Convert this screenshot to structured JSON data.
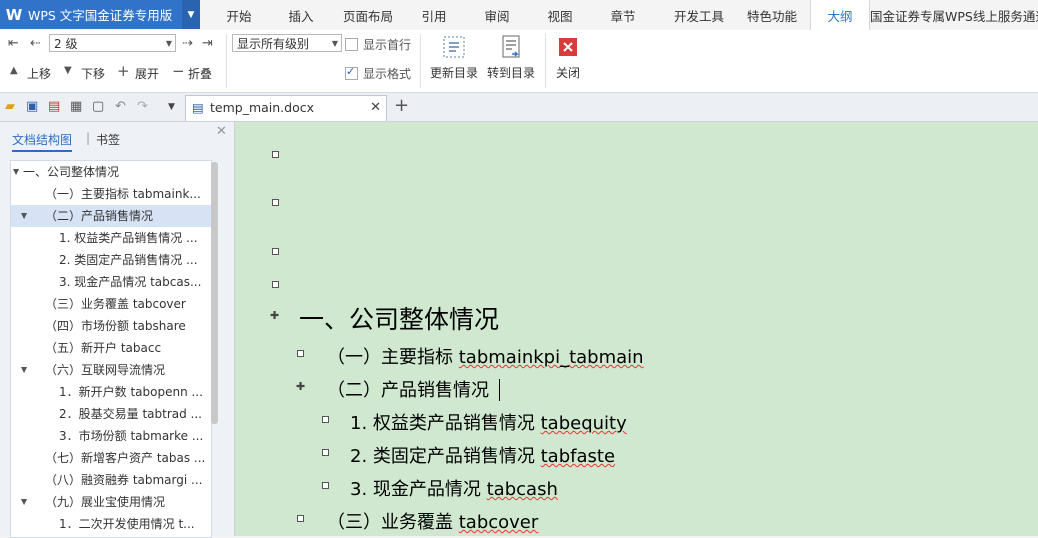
{
  "titlebar": {
    "logo": "W",
    "title": "WPS 文字国金证券专用版"
  },
  "menu_tabs": [
    "开始",
    "插入",
    "页面布局",
    "引用",
    "审阅",
    "视图",
    "章节",
    "开发工具",
    "特色功能",
    "大纲",
    "国金证券专属WPS线上服务通道"
  ],
  "ribbon": {
    "level_value": "2 级",
    "show_levels_value": "显示所有级别",
    "show_first_line": "显示首行",
    "show_format": "显示格式",
    "move_up": "上移",
    "move_down": "下移",
    "expand": "展开",
    "collapse": "折叠",
    "update_toc": "更新目录",
    "goto_toc": "转到目录",
    "close": "关闭"
  },
  "doc_tab": {
    "name": "temp_main.docx"
  },
  "nav": {
    "tab_structure": "文档结构图",
    "tab_bookmark": "书签",
    "items": [
      {
        "label": "一、公司整体情况",
        "indent": 0,
        "toggle": "▲"
      },
      {
        "label": "（一）主要指标 tabmaink...",
        "indent": 1,
        "toggle": ""
      },
      {
        "label": "（二）产品销售情况",
        "indent": 1,
        "toggle": "▲"
      },
      {
        "label": "1. 权益类产品销售情况 ...",
        "indent": 2,
        "toggle": ""
      },
      {
        "label": "2. 类固定产品销售情况 ...",
        "indent": 2,
        "toggle": ""
      },
      {
        "label": "3. 现金产品情况 tabcas...",
        "indent": 2,
        "toggle": ""
      },
      {
        "label": "（三）业务覆盖 tabcover",
        "indent": 1,
        "toggle": ""
      },
      {
        "label": "（四）市场份额 tabshare",
        "indent": 1,
        "toggle": ""
      },
      {
        "label": "（五）新开户 tabacc",
        "indent": 1,
        "toggle": ""
      },
      {
        "label": "（六）互联网导流情况",
        "indent": 1,
        "toggle": "▲"
      },
      {
        "label": "1．新开户数 tabopenn ...",
        "indent": 2,
        "toggle": ""
      },
      {
        "label": "2．股基交易量 tabtrad ...",
        "indent": 2,
        "toggle": ""
      },
      {
        "label": "3．市场份额 tabmarke ...",
        "indent": 2,
        "toggle": ""
      },
      {
        "label": "（七）新增客户资产 tabas ...",
        "indent": 1,
        "toggle": ""
      },
      {
        "label": "（八）融资融券 tabmargi ...",
        "indent": 1,
        "toggle": ""
      },
      {
        "label": "（九）展业宝使用情况",
        "indent": 1,
        "toggle": "▲"
      },
      {
        "label": "1．二次开发使用情况 t...",
        "indent": 2,
        "toggle": ""
      }
    ]
  },
  "outline": {
    "heading1": "一、公司整体情况",
    "l2_a_prefix": "（一）主要指标 ",
    "l2_a_tag": "tabmainkpi_tabmain",
    "l2_b": "（二）产品销售情况",
    "l3_a_prefix": "1. 权益类产品销售情况 ",
    "l3_a_tag": "tabequity",
    "l3_b_prefix": "2. 类固定产品销售情况 ",
    "l3_b_tag": "tabfaste",
    "l3_c_prefix": "3. 现金产品情况 ",
    "l3_c_tag": "tabcash",
    "l2_c_prefix": "（三）业务覆盖 ",
    "l2_c_tag": "tabcover"
  },
  "colors": {
    "accent": "#3173c8",
    "editor_bg": "#cfe8cf",
    "nav_selected": "#d7e3f5"
  }
}
